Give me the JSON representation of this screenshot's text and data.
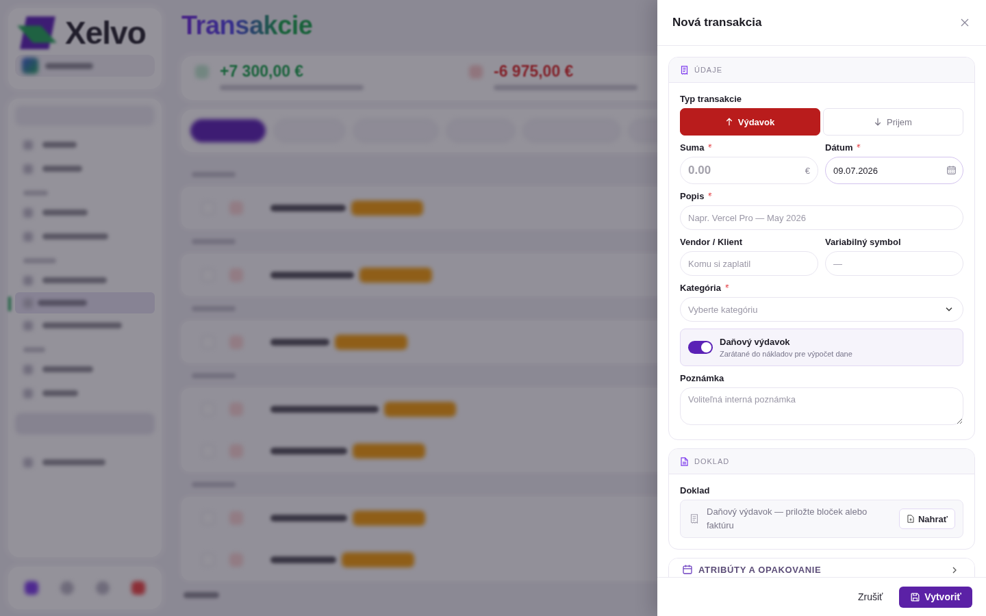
{
  "backdrop": {
    "logo": "Xelvo",
    "page_title": "Transakcie",
    "totals": [
      {
        "kind": "income",
        "amount": "+7 300,00 €"
      },
      {
        "kind": "expense",
        "amount": "-6 975,00 €"
      }
    ]
  },
  "drawer": {
    "title": "Nová transakcia",
    "sections": [
      {
        "kind": "details",
        "heading": "ÚDAJE",
        "expanded": true,
        "type_label": "Typ transakcie",
        "type_options": [
          {
            "kind": "expense",
            "label": "Výdavok",
            "selected": true
          },
          {
            "kind": "income",
            "label": "Prijem",
            "selected": false
          }
        ],
        "rows": [
          {
            "fields": [
              {
                "kind": "amount",
                "label": "Suma",
                "required": true,
                "focused": false,
                "placeholder": "0.00",
                "suffix": "€"
              },
              {
                "kind": "date",
                "label": "Dátum",
                "required": true,
                "focused": true,
                "value": "09.07.2026"
              }
            ]
          },
          {
            "fields": [
              {
                "kind": "text",
                "label": "Popis",
                "required": true,
                "focused": false,
                "placeholder": "Napr. Vercel Pro — May 2026"
              }
            ]
          },
          {
            "fields": [
              {
                "kind": "text",
                "label": "Vendor / Klient",
                "required": false,
                "focused": false,
                "placeholder": "Komu si zaplatil"
              },
              {
                "kind": "text",
                "label": "Variabilný symbol",
                "required": false,
                "focused": false,
                "placeholder": "—"
              }
            ]
          },
          {
            "fields": [
              {
                "kind": "select",
                "label": "Kategória",
                "required": true,
                "focused": false,
                "placeholder": "Vyberte kategóriu"
              }
            ]
          },
          {
            "fields": [
              {
                "kind": "toggle",
                "label": "Daňový výdavok",
                "required": false,
                "focused": false,
                "description": "Zarátané do nákladov pre výpočet dane",
                "on": true
              }
            ]
          },
          {
            "fields": [
              {
                "kind": "textarea",
                "label": "Poznámka",
                "required": false,
                "focused": false,
                "placeholder": "Voliteľná interná poznámka"
              }
            ]
          }
        ]
      },
      {
        "kind": "attachment",
        "heading": "DOKLAD",
        "expanded": true,
        "label": "Doklad",
        "hint": "Daňový výdavok — priložte bloček alebo faktúru",
        "button": "Nahrať"
      },
      {
        "kind": "attributes",
        "heading": "ATRIBÚTY A OPAKOVANIE",
        "expanded": false
      }
    ],
    "actions": [
      {
        "kind": "secondary",
        "label": "Zrušiť"
      },
      {
        "kind": "primary",
        "label": "Vytvoriť"
      }
    ]
  }
}
